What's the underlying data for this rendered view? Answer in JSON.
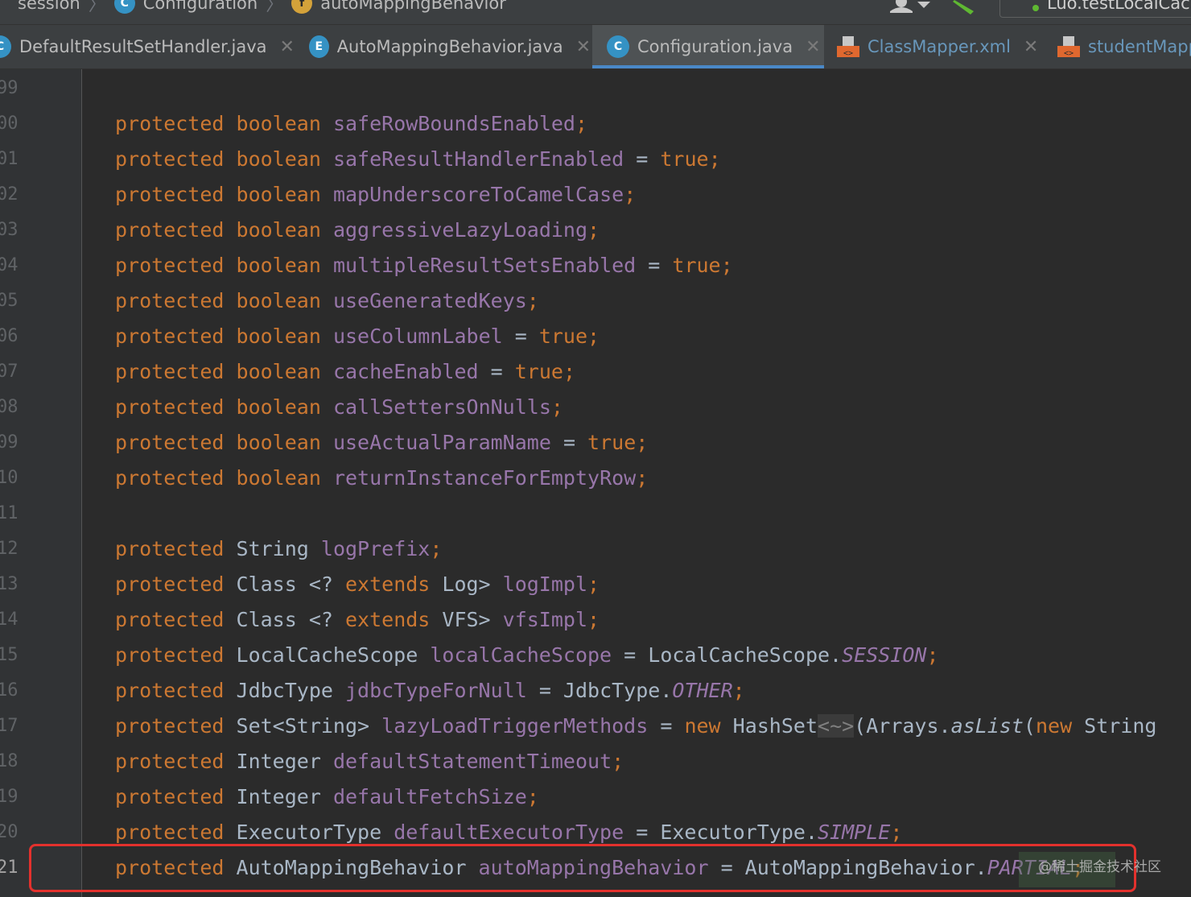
{
  "breadcrumb": {
    "items": [
      {
        "label": "session"
      },
      {
        "label": "Configuration",
        "icon": "class-icon",
        "badge": "C"
      },
      {
        "label": "autoMappingBehavior",
        "icon": "field-icon",
        "badge": "f"
      }
    ],
    "run_config": "Luo.testLocalCache"
  },
  "tabs": [
    {
      "label": "DefaultResultSetHandler.java",
      "icon": "class-icon",
      "badge": "C",
      "active": false
    },
    {
      "label": "AutoMappingBehavior.java",
      "icon": "enum-icon",
      "badge": "E",
      "active": false
    },
    {
      "label": "Configuration.java",
      "icon": "class-icon",
      "badge": "C",
      "active": true
    },
    {
      "label": "ClassMapper.xml",
      "icon": "xml-file-icon",
      "active": false
    },
    {
      "label": "studentMapper.xml",
      "icon": "xml-file-icon",
      "active": false
    }
  ],
  "editor": {
    "line_numbers": [
      "99",
      "00",
      "01",
      "02",
      "03",
      "04",
      "05",
      "06",
      "07",
      "08",
      "09",
      "10",
      "11",
      "12",
      "13",
      "14",
      "15",
      "16",
      "17",
      "18",
      "19",
      "20",
      "21"
    ],
    "current_line": "21",
    "lines": [
      [],
      [
        {
          "t": "protected",
          "c": "kw"
        },
        {
          "t": " "
        },
        {
          "t": "boolean",
          "c": "kw"
        },
        {
          "t": " "
        },
        {
          "t": "safeRowBoundsEnabled",
          "c": "fld"
        },
        {
          "t": ";",
          "c": "kw"
        }
      ],
      [
        {
          "t": "protected",
          "c": "kw"
        },
        {
          "t": " "
        },
        {
          "t": "boolean",
          "c": "kw"
        },
        {
          "t": " "
        },
        {
          "t": "safeResultHandlerEnabled",
          "c": "fld"
        },
        {
          "t": " = "
        },
        {
          "t": "true",
          "c": "kw"
        },
        {
          "t": ";",
          "c": "kw"
        }
      ],
      [
        {
          "t": "protected",
          "c": "kw"
        },
        {
          "t": " "
        },
        {
          "t": "boolean",
          "c": "kw"
        },
        {
          "t": " "
        },
        {
          "t": "mapUnderscoreToCamelCase",
          "c": "fld"
        },
        {
          "t": ";",
          "c": "kw"
        }
      ],
      [
        {
          "t": "protected",
          "c": "kw"
        },
        {
          "t": " "
        },
        {
          "t": "boolean",
          "c": "kw"
        },
        {
          "t": " "
        },
        {
          "t": "aggressiveLazyLoading",
          "c": "fld"
        },
        {
          "t": ";",
          "c": "kw"
        }
      ],
      [
        {
          "t": "protected",
          "c": "kw"
        },
        {
          "t": " "
        },
        {
          "t": "boolean",
          "c": "kw"
        },
        {
          "t": " "
        },
        {
          "t": "multipleResultSetsEnabled",
          "c": "fld"
        },
        {
          "t": " = "
        },
        {
          "t": "true",
          "c": "kw"
        },
        {
          "t": ";",
          "c": "kw"
        }
      ],
      [
        {
          "t": "protected",
          "c": "kw"
        },
        {
          "t": " "
        },
        {
          "t": "boolean",
          "c": "kw"
        },
        {
          "t": " "
        },
        {
          "t": "useGeneratedKeys",
          "c": "fld"
        },
        {
          "t": ";",
          "c": "kw"
        }
      ],
      [
        {
          "t": "protected",
          "c": "kw"
        },
        {
          "t": " "
        },
        {
          "t": "boolean",
          "c": "kw"
        },
        {
          "t": " "
        },
        {
          "t": "useColumnLabel",
          "c": "fld"
        },
        {
          "t": " = "
        },
        {
          "t": "true",
          "c": "kw"
        },
        {
          "t": ";",
          "c": "kw"
        }
      ],
      [
        {
          "t": "protected",
          "c": "kw"
        },
        {
          "t": " "
        },
        {
          "t": "boolean",
          "c": "kw"
        },
        {
          "t": " "
        },
        {
          "t": "cacheEnabled",
          "c": "fld"
        },
        {
          "t": " = "
        },
        {
          "t": "true",
          "c": "kw"
        },
        {
          "t": ";",
          "c": "kw"
        }
      ],
      [
        {
          "t": "protected",
          "c": "kw"
        },
        {
          "t": " "
        },
        {
          "t": "boolean",
          "c": "kw"
        },
        {
          "t": " "
        },
        {
          "t": "callSettersOnNulls",
          "c": "fld"
        },
        {
          "t": ";",
          "c": "kw"
        }
      ],
      [
        {
          "t": "protected",
          "c": "kw"
        },
        {
          "t": " "
        },
        {
          "t": "boolean",
          "c": "kw"
        },
        {
          "t": " "
        },
        {
          "t": "useActualParamName",
          "c": "fld"
        },
        {
          "t": " = "
        },
        {
          "t": "true",
          "c": "kw"
        },
        {
          "t": ";",
          "c": "kw"
        }
      ],
      [
        {
          "t": "protected",
          "c": "kw"
        },
        {
          "t": " "
        },
        {
          "t": "boolean",
          "c": "kw"
        },
        {
          "t": " "
        },
        {
          "t": "returnInstanceForEmptyRow",
          "c": "fld"
        },
        {
          "t": ";",
          "c": "kw"
        }
      ],
      [],
      [
        {
          "t": "protected",
          "c": "kw"
        },
        {
          "t": " String "
        },
        {
          "t": "logPrefix",
          "c": "fld"
        },
        {
          "t": ";",
          "c": "kw"
        }
      ],
      [
        {
          "t": "protected",
          "c": "kw"
        },
        {
          "t": " Class <? "
        },
        {
          "t": "extends",
          "c": "kw"
        },
        {
          "t": " Log> "
        },
        {
          "t": "logImpl",
          "c": "fld"
        },
        {
          "t": ";",
          "c": "kw"
        }
      ],
      [
        {
          "t": "protected",
          "c": "kw"
        },
        {
          "t": " Class <? "
        },
        {
          "t": "extends",
          "c": "kw"
        },
        {
          "t": " VFS> "
        },
        {
          "t": "vfsImpl",
          "c": "fld"
        },
        {
          "t": ";",
          "c": "kw"
        }
      ],
      [
        {
          "t": "protected",
          "c": "kw"
        },
        {
          "t": " LocalCacheScope "
        },
        {
          "t": "localCacheScope",
          "c": "fld"
        },
        {
          "t": " = LocalCacheScope."
        },
        {
          "t": "SESSION",
          "c": "cst"
        },
        {
          "t": ";",
          "c": "kw"
        }
      ],
      [
        {
          "t": "protected",
          "c": "kw"
        },
        {
          "t": " JdbcType "
        },
        {
          "t": "jdbcTypeForNull",
          "c": "fld"
        },
        {
          "t": " = JdbcType."
        },
        {
          "t": "OTHER",
          "c": "cst"
        },
        {
          "t": ";",
          "c": "kw"
        }
      ],
      [
        {
          "t": "protected",
          "c": "kw"
        },
        {
          "t": " Set<String> "
        },
        {
          "t": "lazyLoadTriggerMethods",
          "c": "fld"
        },
        {
          "t": " = "
        },
        {
          "t": "new",
          "c": "kw"
        },
        {
          "t": " HashSet"
        },
        {
          "t": "<~>",
          "c": "dia"
        },
        {
          "t": "(Arrays."
        },
        {
          "t": "asList",
          "c": "mth"
        },
        {
          "t": "("
        },
        {
          "t": "new",
          "c": "kw"
        },
        {
          "t": " String"
        }
      ],
      [
        {
          "t": "protected",
          "c": "kw"
        },
        {
          "t": " Integer "
        },
        {
          "t": "defaultStatementTimeout",
          "c": "fld"
        },
        {
          "t": ";",
          "c": "kw"
        }
      ],
      [
        {
          "t": "protected",
          "c": "kw"
        },
        {
          "t": " Integer "
        },
        {
          "t": "defaultFetchSize",
          "c": "fld"
        },
        {
          "t": ";",
          "c": "kw"
        }
      ],
      [
        {
          "t": "protected",
          "c": "kw"
        },
        {
          "t": " ExecutorType "
        },
        {
          "t": "defaultExecutorType",
          "c": "fld"
        },
        {
          "t": " = ExecutorType."
        },
        {
          "t": "SIMPLE",
          "c": "cst"
        },
        {
          "t": ";",
          "c": "kw"
        }
      ],
      [
        {
          "t": "protected",
          "c": "kw"
        },
        {
          "t": " AutoMappingBehavior "
        },
        {
          "t": "autoMappingBehavior",
          "c": "fld"
        },
        {
          "t": " = AutoMappingBehavior."
        },
        {
          "t": "PARTIAL",
          "c": "cst"
        },
        {
          "t": ";",
          "c": "kw"
        }
      ]
    ]
  },
  "watermark": "@稀土掘金技术社区",
  "colors": {
    "keyword": "#cc7832",
    "field": "#9876aa",
    "plain": "#a9b7c6",
    "highlight_border": "#e3312d",
    "active_tab_underline": "#4a88c7"
  }
}
